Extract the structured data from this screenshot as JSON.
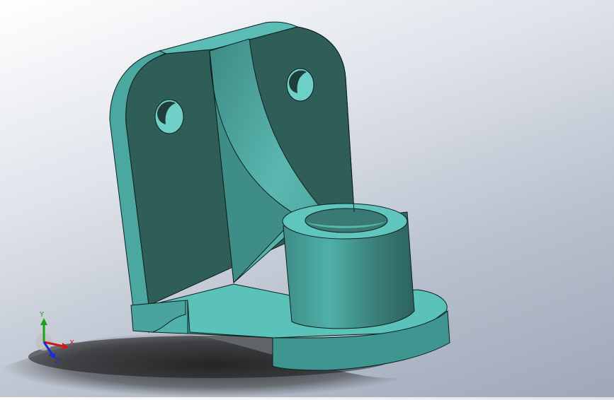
{
  "viewport": {
    "model": "bracket-part",
    "colors": {
      "face_light": "#5bbdb6",
      "face_mid": "#4a9f98",
      "face_dark": "#2f5e59",
      "edge": "#0d1f1d",
      "shadow": "#1a1a1a"
    }
  },
  "triad": {
    "x_label": "X",
    "y_label": "Y",
    "z_label": "Z",
    "colors": {
      "x": "#d01818",
      "y": "#19a319",
      "z": "#1a2bd8"
    }
  }
}
